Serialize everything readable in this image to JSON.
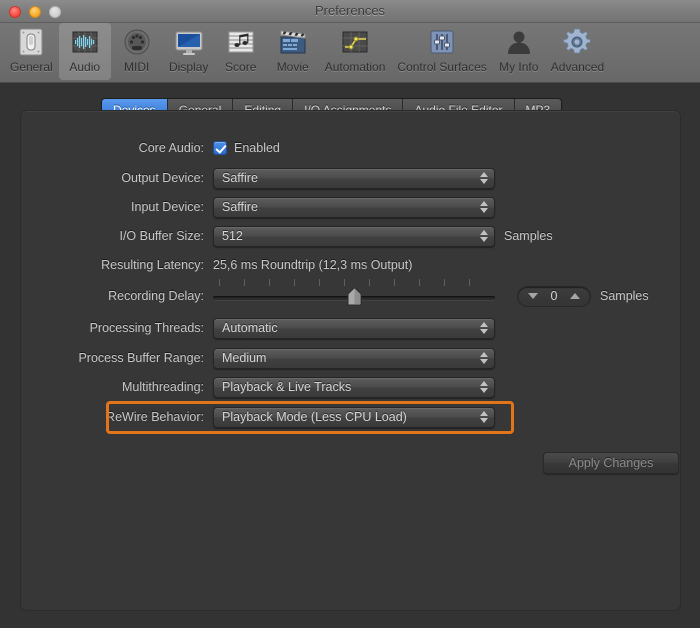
{
  "window": {
    "title": "Preferences",
    "traffic_lights": [
      {
        "name": "close",
        "color": "#f4443a"
      },
      {
        "name": "minimize",
        "color": "#f6a623"
      },
      {
        "name": "zoom",
        "color": "#cfcfcf"
      }
    ]
  },
  "toolbar": {
    "items": [
      {
        "label": "General",
        "icon": "switch-icon",
        "selected": false
      },
      {
        "label": "Audio",
        "icon": "waveform-icon",
        "selected": true
      },
      {
        "label": "MIDI",
        "icon": "midi-port-icon",
        "selected": false
      },
      {
        "label": "Display",
        "icon": "monitor-icon",
        "selected": false
      },
      {
        "label": "Score",
        "icon": "music-notes-icon",
        "selected": false
      },
      {
        "label": "Movie",
        "icon": "clapperboard-icon",
        "selected": false
      },
      {
        "label": "Automation",
        "icon": "automation-curve-icon",
        "selected": false
      },
      {
        "label": "Control Surfaces",
        "icon": "faders-icon",
        "selected": false
      },
      {
        "label": "My Info",
        "icon": "person-icon",
        "selected": false
      },
      {
        "label": "Advanced",
        "icon": "gear-icon",
        "selected": false
      }
    ]
  },
  "tabs": [
    {
      "label": "Devices",
      "active": true
    },
    {
      "label": "General",
      "active": false
    },
    {
      "label": "Editing",
      "active": false
    },
    {
      "label": "I/O Assignments",
      "active": false
    },
    {
      "label": "Audio File Editor",
      "active": false
    },
    {
      "label": "MP3",
      "active": false
    }
  ],
  "form": {
    "core_audio": {
      "label": "Core Audio:",
      "checkbox_label": "Enabled",
      "checked": true
    },
    "output_device": {
      "label": "Output Device:",
      "value": "Saffire"
    },
    "input_device": {
      "label": "Input Device:",
      "value": "Saffire"
    },
    "io_buffer_size": {
      "label": "I/O Buffer Size:",
      "value": "512",
      "unit": "Samples"
    },
    "resulting_latency": {
      "label": "Resulting Latency:",
      "value": "25,6 ms Roundtrip (12,3 ms Output)"
    },
    "recording_delay": {
      "label": "Recording Delay:",
      "value": "0",
      "unit": "Samples",
      "slider_position_percent": 50
    },
    "processing_threads": {
      "label": "Processing Threads:",
      "value": "Automatic"
    },
    "process_buffer_range": {
      "label": "Process Buffer Range:",
      "value": "Medium"
    },
    "multithreading": {
      "label": "Multithreading:",
      "value": "Playback & Live Tracks"
    },
    "rewire_behavior": {
      "label": "ReWire Behavior:",
      "value": "Playback Mode (Less CPU Load)",
      "highlighted": true,
      "highlight_color": "#e2741a"
    }
  },
  "apply_button": {
    "label": "Apply Changes",
    "enabled": false
  }
}
